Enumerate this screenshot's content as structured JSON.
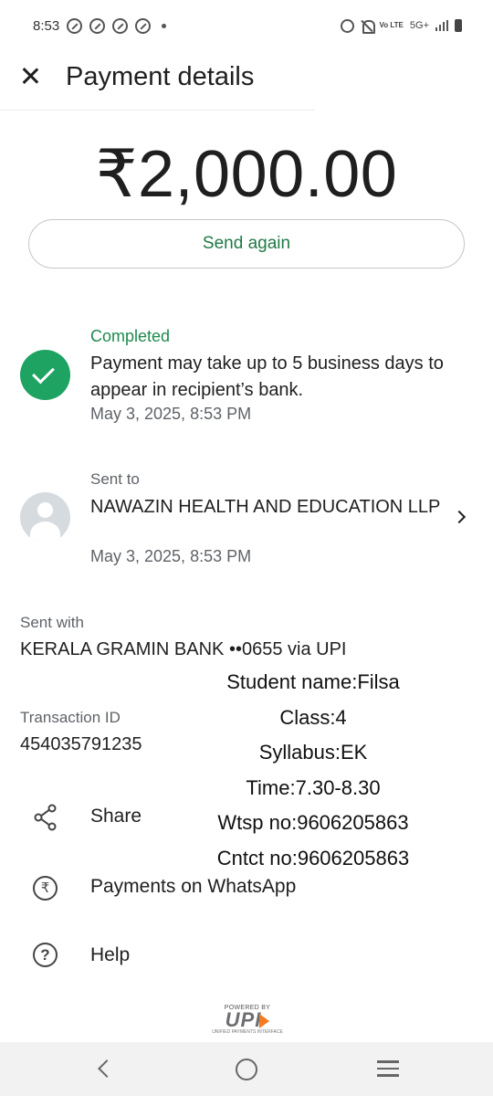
{
  "status_bar": {
    "time": "8:53",
    "network": "5G+",
    "volte": "Vo LTE"
  },
  "header": {
    "title": "Payment details"
  },
  "amount": "₹2,000.00",
  "send_again": "Send again",
  "status": {
    "label": "Completed",
    "description": "Payment may take up to 5 business days to appear in recipient’s bank.",
    "date": "May 3, 2025, 8:53 PM"
  },
  "recipient": {
    "label": "Sent to",
    "name": "NAWAZIN HEALTH AND EDUCATION LLP",
    "date": "May 3, 2025, 8:53 PM"
  },
  "sent_with": {
    "label": "Sent with",
    "value": "KERALA GRAMIN BANK ••0655 via UPI"
  },
  "transaction": {
    "label": "Transaction ID",
    "value": "454035791235"
  },
  "note_lines": [
    "Student name:Filsa",
    "Class:4",
    "Syllabus:EK",
    "Time:7.30-8.30",
    "Wtsp no:9606205863",
    "Cntct no:9606205863"
  ],
  "actions": {
    "share": "Share",
    "whatsapp": "Payments on WhatsApp",
    "help": "Help"
  },
  "upi": {
    "powered": "POWERED BY",
    "mark": "UPI",
    "sub": "UNIFIED PAYMENTS INTERFACE"
  },
  "colors": {
    "accent": "#1e7a45",
    "check": "#1ea362"
  }
}
